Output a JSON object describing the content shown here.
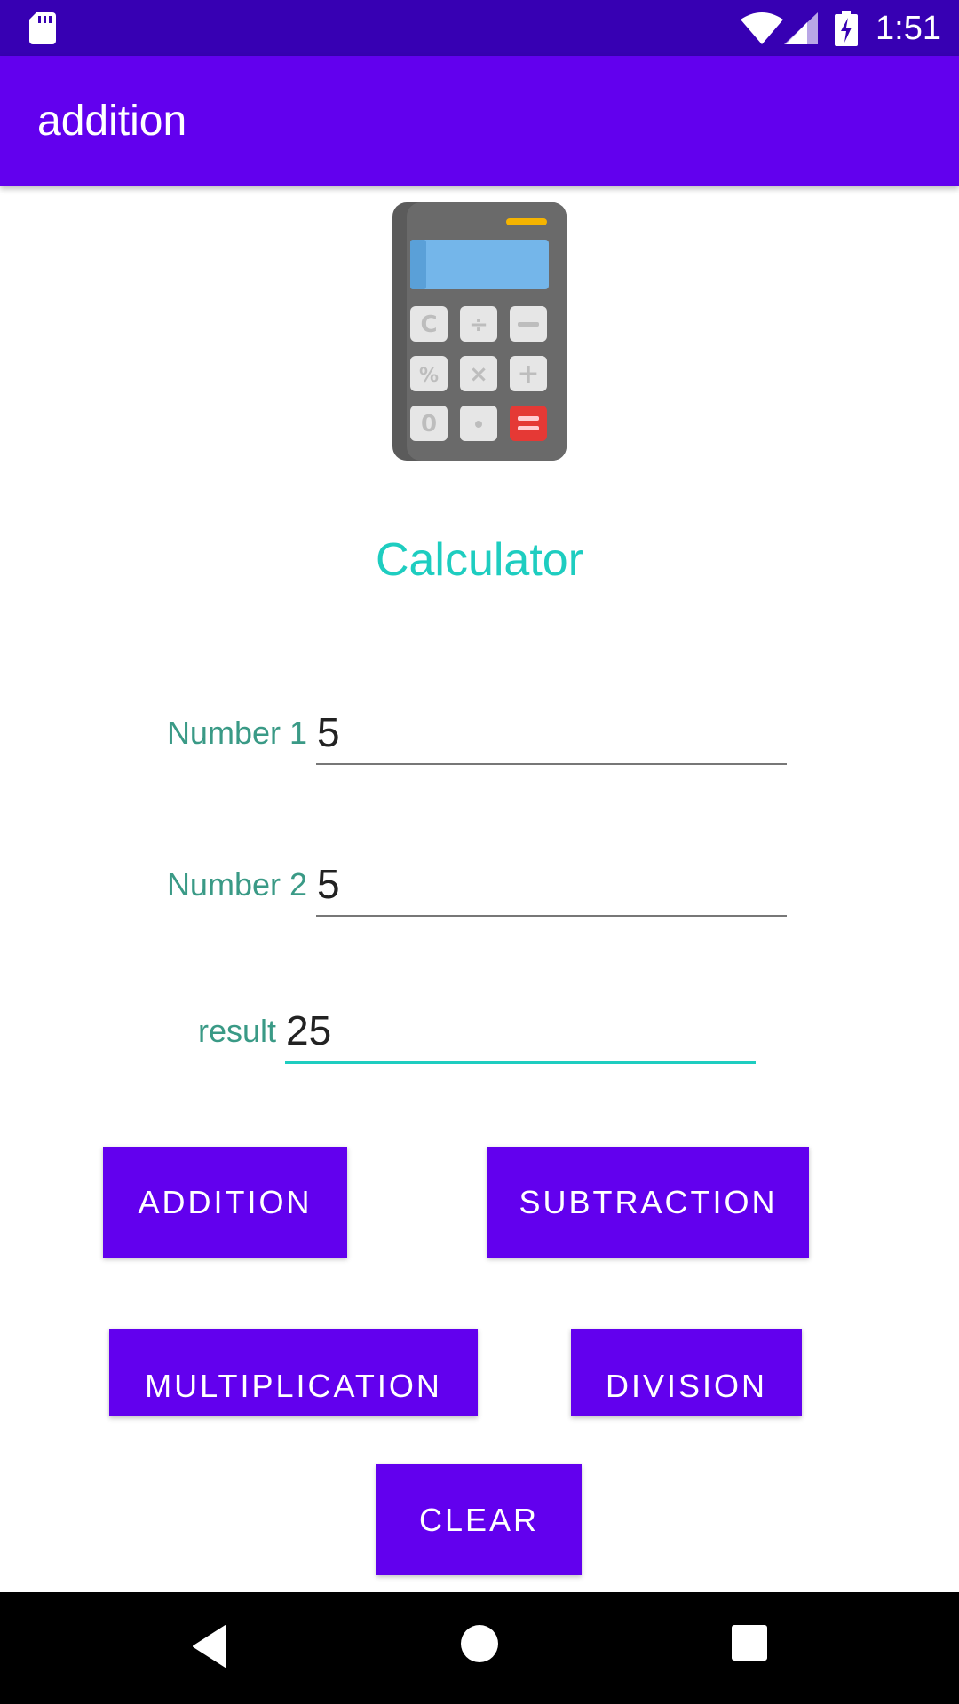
{
  "status_bar": {
    "time": "1:51",
    "icons": [
      "sd-card-icon",
      "wifi-icon",
      "signal-icon",
      "battery-charging-icon"
    ]
  },
  "app_bar": {
    "title": "addition"
  },
  "main": {
    "image": "calculator-icon",
    "heading": "Calculator",
    "fields": [
      {
        "label": "Number 1",
        "value": "5"
      },
      {
        "label": "Number 2",
        "value": "5"
      },
      {
        "label": "result",
        "value": "25"
      }
    ],
    "buttons": {
      "addition": "ADDITION",
      "subtraction": "SUBTRACTION",
      "multiplication": "MULTIPLICATION",
      "division": "DIVISION",
      "clear": "CLEAR"
    }
  },
  "nav_bar": {
    "icons": [
      "back-icon",
      "home-icon",
      "recents-icon"
    ]
  },
  "colors": {
    "primary": "#6200ee",
    "primary_dark": "#3700b3",
    "accent": "#1ecdc0",
    "label": "#3a9a86"
  }
}
